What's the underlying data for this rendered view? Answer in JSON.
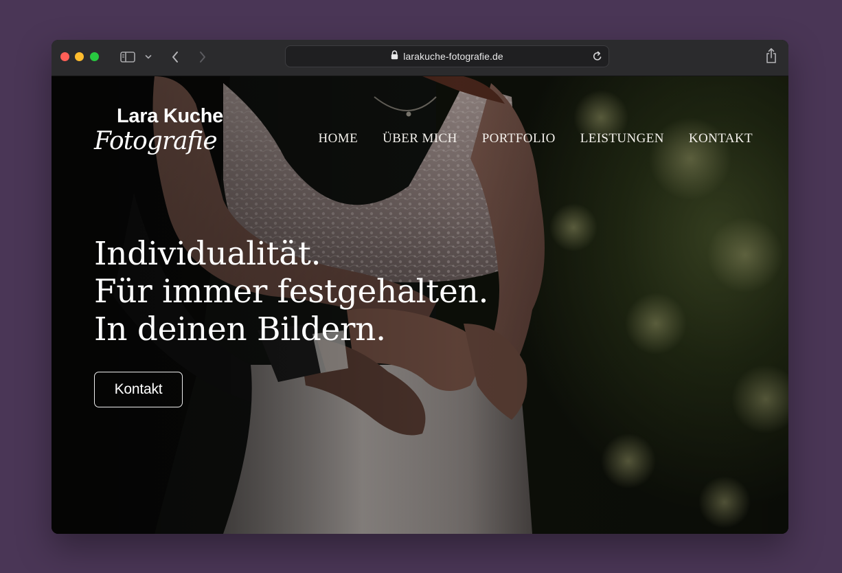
{
  "browser": {
    "url": "larakuche-fotografie.de",
    "icons": {
      "sidebar": "sidebar-icon",
      "chevron": "chevron-down-icon",
      "back": "chevron-left-icon",
      "forward": "chevron-right-icon",
      "lock": "lock-icon",
      "reload": "reload-icon",
      "share": "share-icon"
    }
  },
  "site": {
    "logo": {
      "name": "Lara Kuche",
      "script": "Fotografie"
    },
    "nav": {
      "home": "HOME",
      "about": "ÜBER MICH",
      "portfolio": "PORTFOLIO",
      "services": "LEISTUNGEN",
      "contact": "KONTAKT"
    },
    "hero": {
      "line1": "Individualität.",
      "line2": "Für immer festgehalten.",
      "line3": "In deinen Bildern.",
      "cta": "Kontakt"
    }
  },
  "colors": {
    "desktop_background": "#4a3656",
    "toolbar": "#2b2b2d",
    "text": "#ffffff"
  }
}
